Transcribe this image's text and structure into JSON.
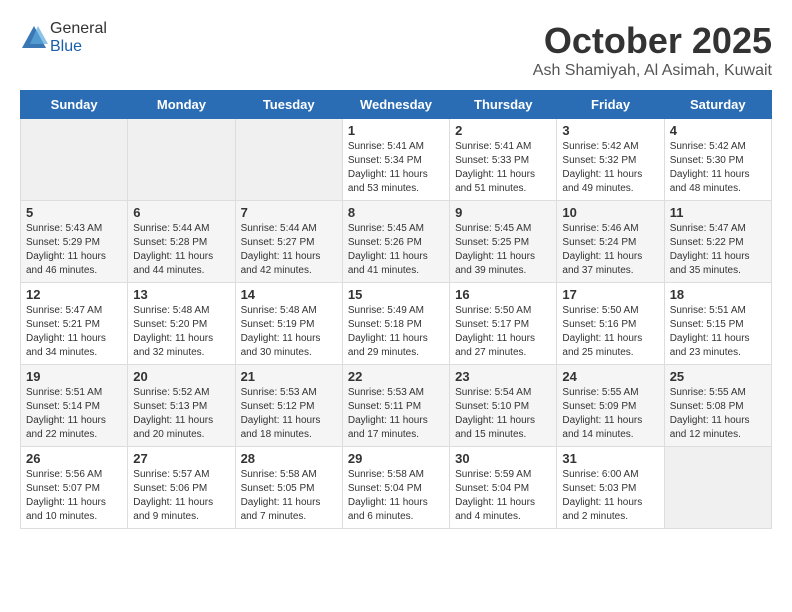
{
  "header": {
    "logo_general": "General",
    "logo_blue": "Blue",
    "month_title": "October 2025",
    "subtitle": "Ash Shamiyah, Al Asimah, Kuwait"
  },
  "weekdays": [
    "Sunday",
    "Monday",
    "Tuesday",
    "Wednesday",
    "Thursday",
    "Friday",
    "Saturday"
  ],
  "weeks": [
    [
      {
        "day": "",
        "sunrise": "",
        "sunset": "",
        "daylight": "",
        "empty": true
      },
      {
        "day": "",
        "sunrise": "",
        "sunset": "",
        "daylight": "",
        "empty": true
      },
      {
        "day": "",
        "sunrise": "",
        "sunset": "",
        "daylight": "",
        "empty": true
      },
      {
        "day": "1",
        "sunrise": "Sunrise: 5:41 AM",
        "sunset": "Sunset: 5:34 PM",
        "daylight": "Daylight: 11 hours and 53 minutes."
      },
      {
        "day": "2",
        "sunrise": "Sunrise: 5:41 AM",
        "sunset": "Sunset: 5:33 PM",
        "daylight": "Daylight: 11 hours and 51 minutes."
      },
      {
        "day": "3",
        "sunrise": "Sunrise: 5:42 AM",
        "sunset": "Sunset: 5:32 PM",
        "daylight": "Daylight: 11 hours and 49 minutes."
      },
      {
        "day": "4",
        "sunrise": "Sunrise: 5:42 AM",
        "sunset": "Sunset: 5:30 PM",
        "daylight": "Daylight: 11 hours and 48 minutes."
      }
    ],
    [
      {
        "day": "5",
        "sunrise": "Sunrise: 5:43 AM",
        "sunset": "Sunset: 5:29 PM",
        "daylight": "Daylight: 11 hours and 46 minutes."
      },
      {
        "day": "6",
        "sunrise": "Sunrise: 5:44 AM",
        "sunset": "Sunset: 5:28 PM",
        "daylight": "Daylight: 11 hours and 44 minutes."
      },
      {
        "day": "7",
        "sunrise": "Sunrise: 5:44 AM",
        "sunset": "Sunset: 5:27 PM",
        "daylight": "Daylight: 11 hours and 42 minutes."
      },
      {
        "day": "8",
        "sunrise": "Sunrise: 5:45 AM",
        "sunset": "Sunset: 5:26 PM",
        "daylight": "Daylight: 11 hours and 41 minutes."
      },
      {
        "day": "9",
        "sunrise": "Sunrise: 5:45 AM",
        "sunset": "Sunset: 5:25 PM",
        "daylight": "Daylight: 11 hours and 39 minutes."
      },
      {
        "day": "10",
        "sunrise": "Sunrise: 5:46 AM",
        "sunset": "Sunset: 5:24 PM",
        "daylight": "Daylight: 11 hours and 37 minutes."
      },
      {
        "day": "11",
        "sunrise": "Sunrise: 5:47 AM",
        "sunset": "Sunset: 5:22 PM",
        "daylight": "Daylight: 11 hours and 35 minutes."
      }
    ],
    [
      {
        "day": "12",
        "sunrise": "Sunrise: 5:47 AM",
        "sunset": "Sunset: 5:21 PM",
        "daylight": "Daylight: 11 hours and 34 minutes."
      },
      {
        "day": "13",
        "sunrise": "Sunrise: 5:48 AM",
        "sunset": "Sunset: 5:20 PM",
        "daylight": "Daylight: 11 hours and 32 minutes."
      },
      {
        "day": "14",
        "sunrise": "Sunrise: 5:48 AM",
        "sunset": "Sunset: 5:19 PM",
        "daylight": "Daylight: 11 hours and 30 minutes."
      },
      {
        "day": "15",
        "sunrise": "Sunrise: 5:49 AM",
        "sunset": "Sunset: 5:18 PM",
        "daylight": "Daylight: 11 hours and 29 minutes."
      },
      {
        "day": "16",
        "sunrise": "Sunrise: 5:50 AM",
        "sunset": "Sunset: 5:17 PM",
        "daylight": "Daylight: 11 hours and 27 minutes."
      },
      {
        "day": "17",
        "sunrise": "Sunrise: 5:50 AM",
        "sunset": "Sunset: 5:16 PM",
        "daylight": "Daylight: 11 hours and 25 minutes."
      },
      {
        "day": "18",
        "sunrise": "Sunrise: 5:51 AM",
        "sunset": "Sunset: 5:15 PM",
        "daylight": "Daylight: 11 hours and 23 minutes."
      }
    ],
    [
      {
        "day": "19",
        "sunrise": "Sunrise: 5:51 AM",
        "sunset": "Sunset: 5:14 PM",
        "daylight": "Daylight: 11 hours and 22 minutes."
      },
      {
        "day": "20",
        "sunrise": "Sunrise: 5:52 AM",
        "sunset": "Sunset: 5:13 PM",
        "daylight": "Daylight: 11 hours and 20 minutes."
      },
      {
        "day": "21",
        "sunrise": "Sunrise: 5:53 AM",
        "sunset": "Sunset: 5:12 PM",
        "daylight": "Daylight: 11 hours and 18 minutes."
      },
      {
        "day": "22",
        "sunrise": "Sunrise: 5:53 AM",
        "sunset": "Sunset: 5:11 PM",
        "daylight": "Daylight: 11 hours and 17 minutes."
      },
      {
        "day": "23",
        "sunrise": "Sunrise: 5:54 AM",
        "sunset": "Sunset: 5:10 PM",
        "daylight": "Daylight: 11 hours and 15 minutes."
      },
      {
        "day": "24",
        "sunrise": "Sunrise: 5:55 AM",
        "sunset": "Sunset: 5:09 PM",
        "daylight": "Daylight: 11 hours and 14 minutes."
      },
      {
        "day": "25",
        "sunrise": "Sunrise: 5:55 AM",
        "sunset": "Sunset: 5:08 PM",
        "daylight": "Daylight: 11 hours and 12 minutes."
      }
    ],
    [
      {
        "day": "26",
        "sunrise": "Sunrise: 5:56 AM",
        "sunset": "Sunset: 5:07 PM",
        "daylight": "Daylight: 11 hours and 10 minutes."
      },
      {
        "day": "27",
        "sunrise": "Sunrise: 5:57 AM",
        "sunset": "Sunset: 5:06 PM",
        "daylight": "Daylight: 11 hours and 9 minutes."
      },
      {
        "day": "28",
        "sunrise": "Sunrise: 5:58 AM",
        "sunset": "Sunset: 5:05 PM",
        "daylight": "Daylight: 11 hours and 7 minutes."
      },
      {
        "day": "29",
        "sunrise": "Sunrise: 5:58 AM",
        "sunset": "Sunset: 5:04 PM",
        "daylight": "Daylight: 11 hours and 6 minutes."
      },
      {
        "day": "30",
        "sunrise": "Sunrise: 5:59 AM",
        "sunset": "Sunset: 5:04 PM",
        "daylight": "Daylight: 11 hours and 4 minutes."
      },
      {
        "day": "31",
        "sunrise": "Sunrise: 6:00 AM",
        "sunset": "Sunset: 5:03 PM",
        "daylight": "Daylight: 11 hours and 2 minutes."
      },
      {
        "day": "",
        "sunrise": "",
        "sunset": "",
        "daylight": "",
        "empty": true
      }
    ]
  ]
}
